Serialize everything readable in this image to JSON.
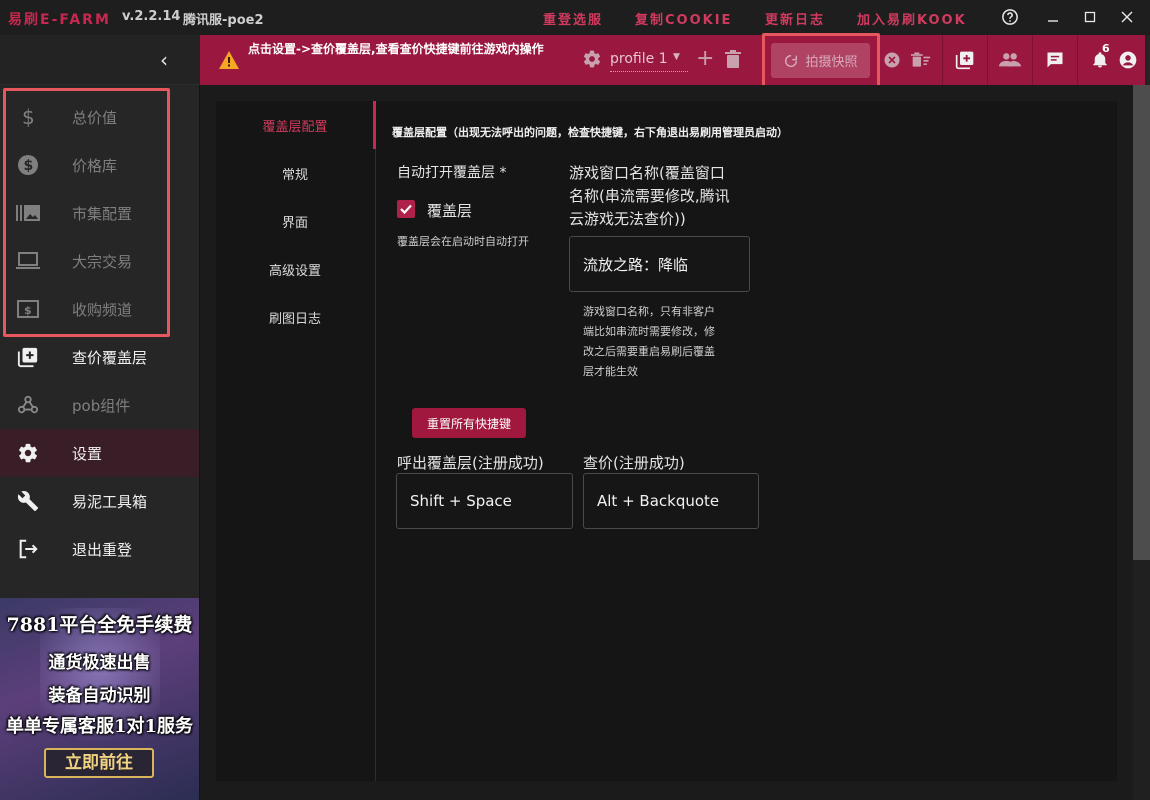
{
  "titlebar": {
    "app_name": "易刷E-FARM",
    "version": "v.2.2.14",
    "server": "腾讯服-poe2",
    "links": [
      "重登选服",
      "复制COOKIE",
      "更新日志",
      "加入易刷KOOK"
    ]
  },
  "header": {
    "notice": "点击设置->查价覆盖层,查看查价快捷键前往游戏内操作",
    "profile": "profile 1",
    "snapshot_button": "拍摄快照",
    "notification_count": "6"
  },
  "sidebar": {
    "items": [
      {
        "label": "总价值",
        "icon": "dollar-icon"
      },
      {
        "label": "价格库",
        "icon": "dollar-circle-icon"
      },
      {
        "label": "市集配置",
        "icon": "gallery-icon"
      },
      {
        "label": "大宗交易",
        "icon": "laptop-icon"
      },
      {
        "label": "收购频道",
        "icon": "money-bill-icon"
      },
      {
        "label": "查价覆盖层",
        "icon": "add-box-icon"
      },
      {
        "label": "pob组件",
        "icon": "webhook-icon"
      },
      {
        "label": "设置",
        "icon": "gear-icon"
      },
      {
        "label": "易泥工具箱",
        "icon": "wrench-icon"
      },
      {
        "label": "退出重登",
        "icon": "logout-icon"
      }
    ],
    "promo": {
      "line1": "7881平台全免手续费",
      "line2": "通货极速出售",
      "line3": "装备自动识别",
      "line4": "单单专属客服1对1服务",
      "cta": "立即前往"
    }
  },
  "settings": {
    "subnav": [
      "覆盖层配置",
      "常规",
      "界面",
      "高级设置",
      "刷图日志"
    ],
    "section_title": "覆盖层配置（出现无法呼出的问题，检查快捷键，右下角退出易刷用管理员启动）",
    "auto_open_label": "自动打开覆盖层 *",
    "overlay_checkbox_label": "覆盖层",
    "overlay_hint": "覆盖层会在启动时自动打开",
    "window_name_label_lines": [
      "游戏窗口名称(覆盖窗口",
      "名称(串流需要修改,腾讯",
      "云游戏无法查价))"
    ],
    "window_name_value": "流放之路：降临",
    "window_name_hint_lines": [
      "游戏窗口名称，只有非客户",
      "端比如串流时需要修改，修",
      "改之后需要重启易刷后覆盖",
      "层才能生效"
    ],
    "reset_button": "重置所有快捷键",
    "hotkey_open_label": "呼出覆盖层(注册成功)",
    "hotkey_open_value": "Shift + Space",
    "hotkey_price_label": "查价(注册成功)",
    "hotkey_price_value": "Alt + Backquote"
  },
  "colors": {
    "accent": "#c8284f",
    "banner": "#9a1840",
    "annotation": "#e6585e"
  }
}
